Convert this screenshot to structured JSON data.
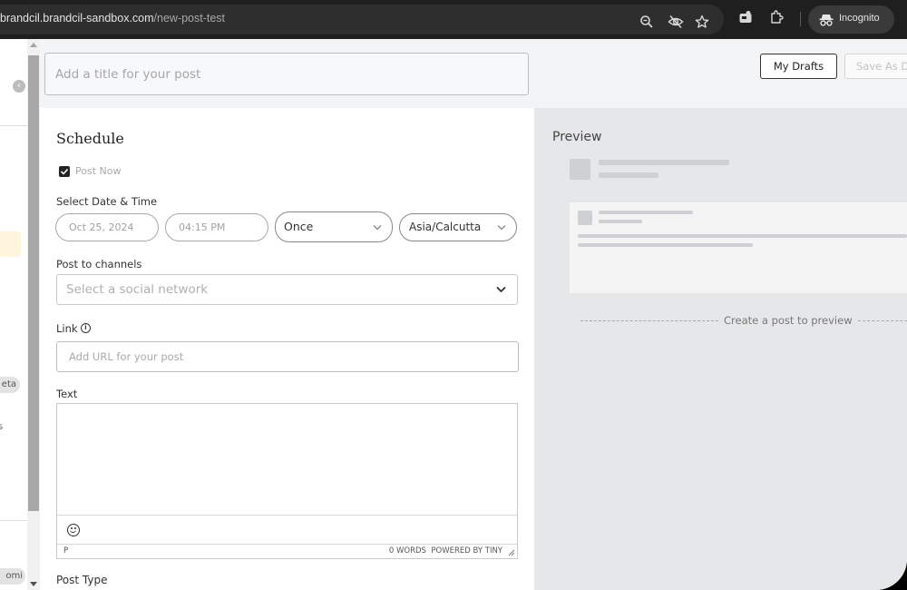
{
  "browser": {
    "url_host": "brandcil.brandcil-sandbox.com",
    "url_path": "/new-post-test",
    "incognito_label": "Incognito"
  },
  "sidebar": {
    "beta_badge": "eta",
    "item_fragment": "s",
    "admin_badge": "omi"
  },
  "header": {
    "title_placeholder": "Add a title for your post",
    "my_drafts_label": "My Drafts",
    "save_as_draft_label": "Save As D"
  },
  "form": {
    "schedule_heading": "Schedule",
    "post_now_label": "Post Now",
    "post_now_checked": true,
    "date_time_label": "Select Date & Time",
    "date_value": "Oct 25, 2024",
    "time_value": "04:15 PM",
    "repeat_value": "Once",
    "timezone_value": "Asia/Calcutta",
    "channels_label": "Post to channels",
    "channels_placeholder": "Select a social network",
    "link_label": "Link",
    "link_placeholder": "Add URL for your post",
    "text_label": "Text",
    "editor_status_path": "P",
    "editor_word_count": "0 WORDS",
    "editor_powered_by": "POWERED BY TINY",
    "post_type_label": "Post Type"
  },
  "preview": {
    "title": "Preview",
    "empty_message": "Create a post to preview"
  },
  "colors": {
    "active_sidebar_bg": "#fff4dc",
    "preview_bg": "#e6e7e9",
    "header_bg": "#f3f4f6"
  }
}
